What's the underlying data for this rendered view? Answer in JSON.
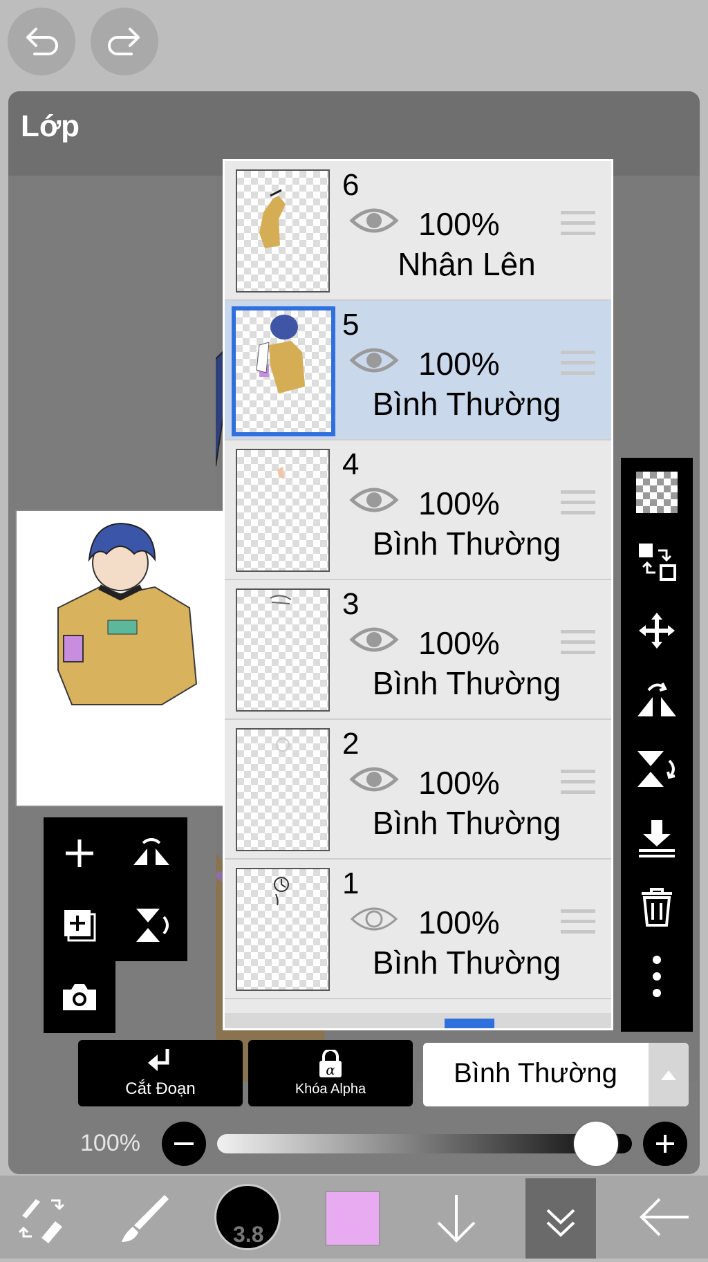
{
  "panel": {
    "title": "Lớp"
  },
  "layers": [
    {
      "number": "6",
      "opacity": "100%",
      "blend": "Nhân Lên",
      "visible": true,
      "selected": false
    },
    {
      "number": "5",
      "opacity": "100%",
      "blend": "Bình Thường",
      "visible": true,
      "selected": true
    },
    {
      "number": "4",
      "opacity": "100%",
      "blend": "Bình Thường",
      "visible": true,
      "selected": false
    },
    {
      "number": "3",
      "opacity": "100%",
      "blend": "Bình Thường",
      "visible": true,
      "selected": false
    },
    {
      "number": "2",
      "opacity": "100%",
      "blend": "Bình Thường",
      "visible": true,
      "selected": false
    },
    {
      "number": "1",
      "opacity": "100%",
      "blend": "Bình Thường",
      "visible": false,
      "selected": false
    }
  ],
  "bottom_controls": {
    "clipping_label": "Cắt Đoạn",
    "alpha_lock_label": "Khóa Alpha",
    "blend_mode": "Bình Thường",
    "opacity_label": "100%",
    "opacity_value": 1.0
  },
  "toolbar": {
    "brush_size": "3.8",
    "color": "#e8aaf0"
  },
  "colors": {
    "selection": "#2f6fde",
    "selected_row": "#cad8ec"
  }
}
